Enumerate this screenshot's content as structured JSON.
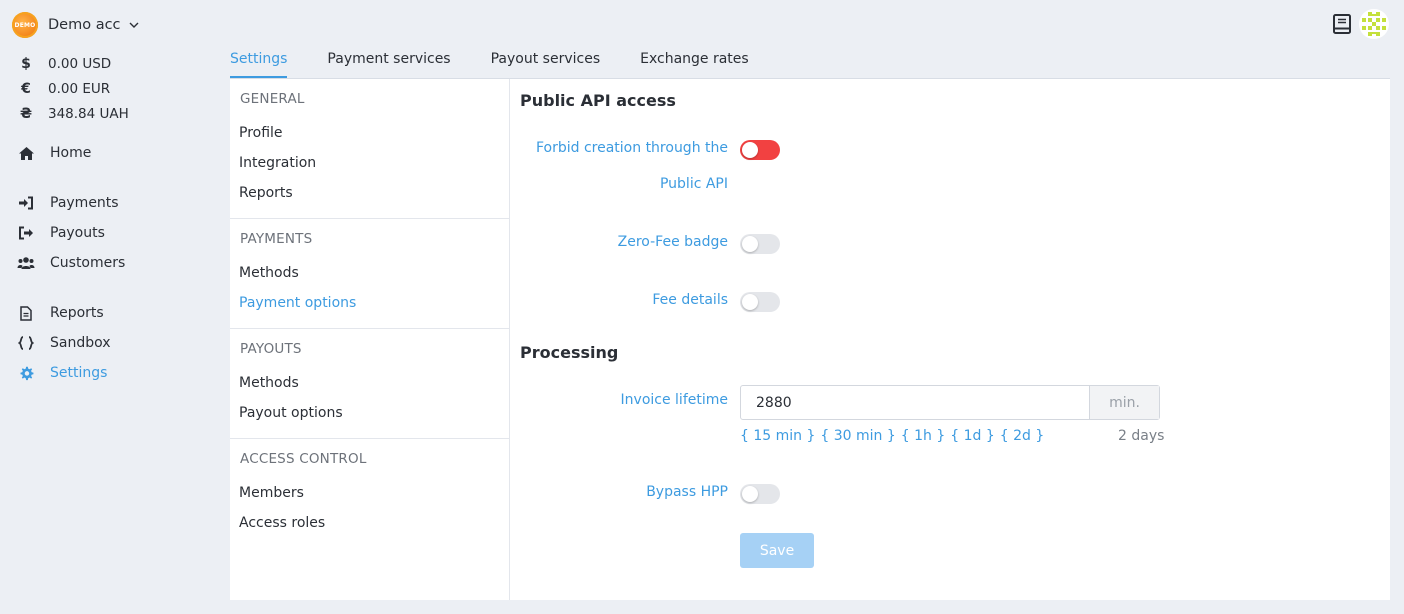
{
  "account": {
    "logo_text": "DEMO",
    "name": "Demo acc"
  },
  "balances": [
    {
      "symbol": "$",
      "amount": "0.00 USD"
    },
    {
      "symbol": "€",
      "amount": "0.00 EUR"
    },
    {
      "symbol": "₴",
      "amount": "348.84 UAH"
    }
  ],
  "nav": {
    "home": "Home",
    "payments": "Payments",
    "payouts": "Payouts",
    "customers": "Customers",
    "reports": "Reports",
    "sandbox": "Sandbox",
    "settings": "Settings"
  },
  "tabs": [
    "Settings",
    "Payment services",
    "Payout services",
    "Exchange rates"
  ],
  "subnav": {
    "general": {
      "title": "GENERAL",
      "items": [
        "Profile",
        "Integration",
        "Reports"
      ]
    },
    "payments": {
      "title": "PAYMENTS",
      "items": [
        "Methods",
        "Payment options"
      ]
    },
    "payouts": {
      "title": "PAYOUTS",
      "items": [
        "Methods",
        "Payout options"
      ]
    },
    "access": {
      "title": "ACCESS CONTROL",
      "items": [
        "Members",
        "Access roles"
      ]
    }
  },
  "content": {
    "public_api_title": "Public API access",
    "forbid_label_line1": "Forbid creation through the",
    "forbid_label_line2": "Public API",
    "zero_fee_label": "Zero-Fee badge",
    "fee_details_label": "Fee details",
    "processing_title": "Processing",
    "invoice_lifetime_label": "Invoice lifetime",
    "invoice_lifetime_value": "2880",
    "invoice_lifetime_unit": "min.",
    "presets": [
      "{ 15 min }",
      "{ 30 min }",
      "{ 1h }",
      "{ 1d }",
      "{ 2d }"
    ],
    "preset_hint": "2 days",
    "bypass_hpp_label": "Bypass HPP",
    "save_label": "Save"
  },
  "toggles": {
    "forbid_public_api": true,
    "zero_fee_badge": false,
    "fee_details": false,
    "bypass_hpp": false
  },
  "colors": {
    "accent": "#3d9be0",
    "toggle_on": "#f24141",
    "save_disabled": "#a6d1f5"
  }
}
